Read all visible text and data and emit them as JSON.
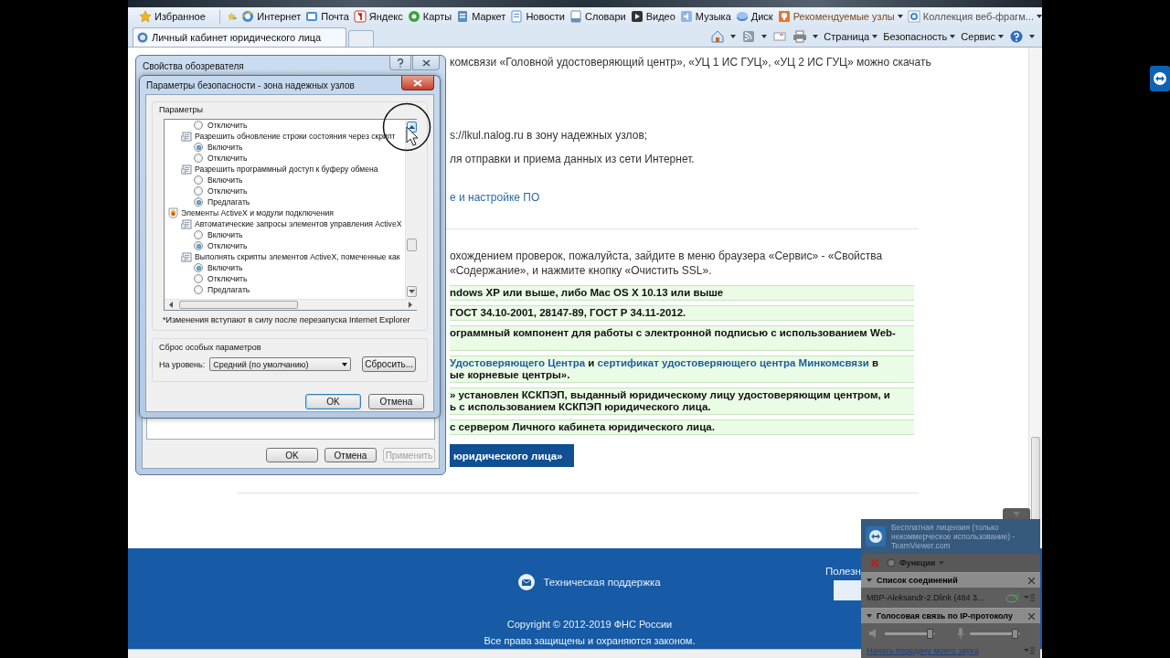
{
  "browser": {
    "favorites_bar": {
      "favorites": "Избранное",
      "links": [
        {
          "kind": "ie",
          "label": "Интернет"
        },
        {
          "kind": "mail",
          "label": "Почта"
        },
        {
          "kind": "yandex",
          "label": "Яндекс"
        },
        {
          "kind": "maps",
          "label": "Карты"
        },
        {
          "kind": "market",
          "label": "Маркет"
        },
        {
          "kind": "news",
          "label": "Новости"
        },
        {
          "kind": "dict",
          "label": "Словари"
        },
        {
          "kind": "video",
          "label": "Видео"
        },
        {
          "kind": "music",
          "label": "Музыка"
        },
        {
          "kind": "disk",
          "label": "Диск"
        }
      ],
      "dropdowns": [
        {
          "kind": "recommended",
          "label": "Рекомендуемые узлы"
        },
        {
          "kind": "gallery",
          "label": "Коллекция веб-фрагм..."
        }
      ]
    },
    "tabs": [
      {
        "label": "Личный кабинет юридического лица",
        "selected": true
      }
    ],
    "command_bar": {
      "menus": [
        {
          "label": "Страница"
        },
        {
          "label": "Безопасность"
        },
        {
          "label": "Сервис"
        }
      ]
    }
  },
  "page": {
    "intro_lines": [
      "комсвязи «Головной удостоверяющий центр», «УЦ 1 ИС ГУЦ», «УЦ 2 ИС ГУЦ» можно скачать",
      "s://lkul.nalog.ru в зону надежных узлов;",
      "ля отправки и приема данных из сети Интернет."
    ],
    "setup_link": "е и настройке ПО",
    "ssl_note": [
      "охождением проверок, пожалуйста, зайдите в меню браузера «Сервис» - «Свойства",
      "«Содержание», и нажмите кнопку «Очистить SSL»."
    ],
    "requirements": [
      {
        "lines": [
          {
            "parts": [
              {
                "kind": "text",
                "text": "ndows XP или выше, либо Mac OS X 10.13 или выше"
              }
            ]
          }
        ]
      },
      {
        "lines": [
          {
            "parts": [
              {
                "kind": "text",
                "text": "ГОСТ 34.10-2001, 28147-89, ГОСТ Р 34.11-2012."
              }
            ]
          }
        ]
      },
      {
        "lines": [
          {
            "parts": [
              {
                "kind": "text",
                "text": "ограммный компонент для работы с электронной подписью с использованием Web-"
              }
            ]
          }
        ]
      },
      {
        "lines": [
          {
            "parts": [
              {
                "kind": "link",
                "text": "Удостоверяющего Центра"
              },
              {
                "kind": "text",
                "text": " и "
              },
              {
                "kind": "link",
                "text": "сертификат удостоверяющего центра Минкомсвязи"
              },
              {
                "kind": "text",
                "text": " в"
              }
            ]
          },
          {
            "parts": [
              {
                "kind": "text",
                "text": "ые корневые центры»."
              }
            ]
          }
        ]
      },
      {
        "lines": [
          {
            "parts": [
              {
                "kind": "text",
                "text": "» установлен КСКПЭП, выданный юридическому лицу удостоверяющим центром, и"
              }
            ]
          },
          {
            "parts": [
              {
                "kind": "text",
                "text": "ь с использованием КСКПЭП юридического лица."
              }
            ]
          }
        ]
      },
      {
        "lines": [
          {
            "parts": [
              {
                "kind": "text",
                "text": "с сервером Личного кабинета юридического лица."
              }
            ]
          }
        ]
      }
    ],
    "button": "юридического лица»",
    "footer": {
      "support": "Техническая поддержка",
      "useful": "Полезн",
      "copyright": "Copyright © 2012-2019 ФНС России",
      "rights": "Все права защищены и охраняются законом."
    }
  },
  "internet_options": {
    "title": "Свойства обозревателя",
    "buttons": [
      {
        "label": "OK",
        "disabled": false
      },
      {
        "label": "Отмена",
        "disabled": false
      },
      {
        "label": "Применить",
        "disabled": true
      }
    ]
  },
  "security_dialog": {
    "title": "Параметры безопасности - зона надежных узлов",
    "settings_group": "Параметры",
    "settings": [
      {
        "kind": "option",
        "label": "Отключить",
        "selected": false
      },
      {
        "kind": "setting",
        "label": "Разрешить обновление строки состояния через скрипт",
        "children": [
          {
            "kind": "option",
            "label": "Включить",
            "selected": true
          },
          {
            "kind": "option",
            "label": "Отключить",
            "selected": false
          }
        ]
      },
      {
        "kind": "setting",
        "label": "Разрешить программный доступ к буферу обмена",
        "children": [
          {
            "kind": "option",
            "label": "Включить",
            "selected": false
          },
          {
            "kind": "option",
            "label": "Отключить",
            "selected": false
          },
          {
            "kind": "option",
            "label": "Предлагать",
            "selected": true
          }
        ]
      },
      {
        "kind": "category",
        "label": "Элементы ActiveX и модули подключения",
        "children": [
          {
            "kind": "setting",
            "label": "Автоматические запросы элементов управления ActiveX",
            "children": [
              {
                "kind": "option",
                "label": "Включить",
                "selected": false
              },
              {
                "kind": "option",
                "label": "Отключить",
                "selected": true
              }
            ]
          },
          {
            "kind": "setting",
            "label": "Выполнять скрипты элементов ActiveX, помеченные как",
            "children": [
              {
                "kind": "option",
                "label": "Включить",
                "selected": true
              },
              {
                "kind": "option",
                "label": "Отключить",
                "selected": false
              },
              {
                "kind": "option",
                "label": "Предлагать",
                "selected": false
              }
            ]
          }
        ]
      }
    ],
    "note": "*Изменения вступают в силу после перезапуска Internet Explorer",
    "reset_group": "Сброс особых параметров",
    "level_label": "На уровень:",
    "level_value": "Средний (по умолчанию)",
    "reset_button": "Сбросить...",
    "buttons": [
      {
        "label": "OK",
        "default": true
      },
      {
        "label": "Отмена",
        "default": false
      }
    ]
  },
  "teamviewer": {
    "license": "Бесплатная лицензия (только некоммерческое использование) - TeamViewer.com",
    "functions": "Функции",
    "sections": [
      {
        "kind": "connections",
        "title": "Список соединений",
        "rows": [
          "MBP-Aleksandr-2.Dlink (484 3..."
        ]
      },
      {
        "kind": "voice",
        "title": "Голосовая связь по IP-протоколу",
        "sliders": [
          {
            "kind": "speaker"
          },
          {
            "kind": "microphone"
          }
        ],
        "link": "Начать передачу моего звука"
      }
    ]
  }
}
